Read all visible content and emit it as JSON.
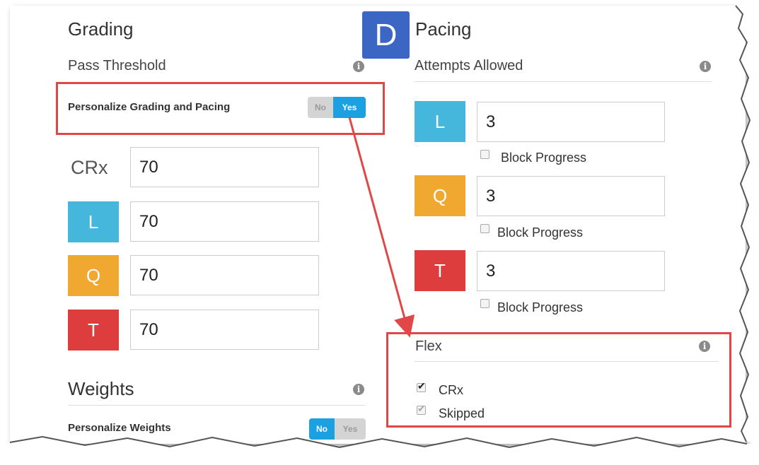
{
  "grading": {
    "title": "Grading",
    "pass_threshold_label": "Pass Threshold",
    "personalize_label": "Personalize Grading and Pacing",
    "toggle_no": "No",
    "toggle_yes": "Yes",
    "crx_label": "CRx",
    "crx_value": "70",
    "l_badge": "L",
    "l_value": "70",
    "q_badge": "Q",
    "q_value": "70",
    "t_badge": "T",
    "t_value": "70"
  },
  "weights": {
    "title": "Weights",
    "personalize_label": "Personalize Weights",
    "toggle_no": "No",
    "toggle_yes": "Yes"
  },
  "pacing": {
    "badge": "D",
    "title": "Pacing",
    "attempts_label": "Attempts Allowed",
    "rows": [
      {
        "badge": "L",
        "value": "3",
        "block_label": "Block Progress"
      },
      {
        "badge": "Q",
        "value": "3",
        "block_label": "Block Progress"
      },
      {
        "badge": "T",
        "value": "3",
        "block_label": "Block Progress"
      }
    ]
  },
  "flex": {
    "title": "Flex",
    "crx_label": "CRx",
    "skipped_label": "Skipped"
  },
  "colors": {
    "accent_blue": "#1ba1e2",
    "badge_l": "#45b7dc",
    "badge_q": "#f0a830",
    "badge_t": "#de3d3d",
    "badge_d": "#3c66c4",
    "highlight_red": "#e04848"
  }
}
